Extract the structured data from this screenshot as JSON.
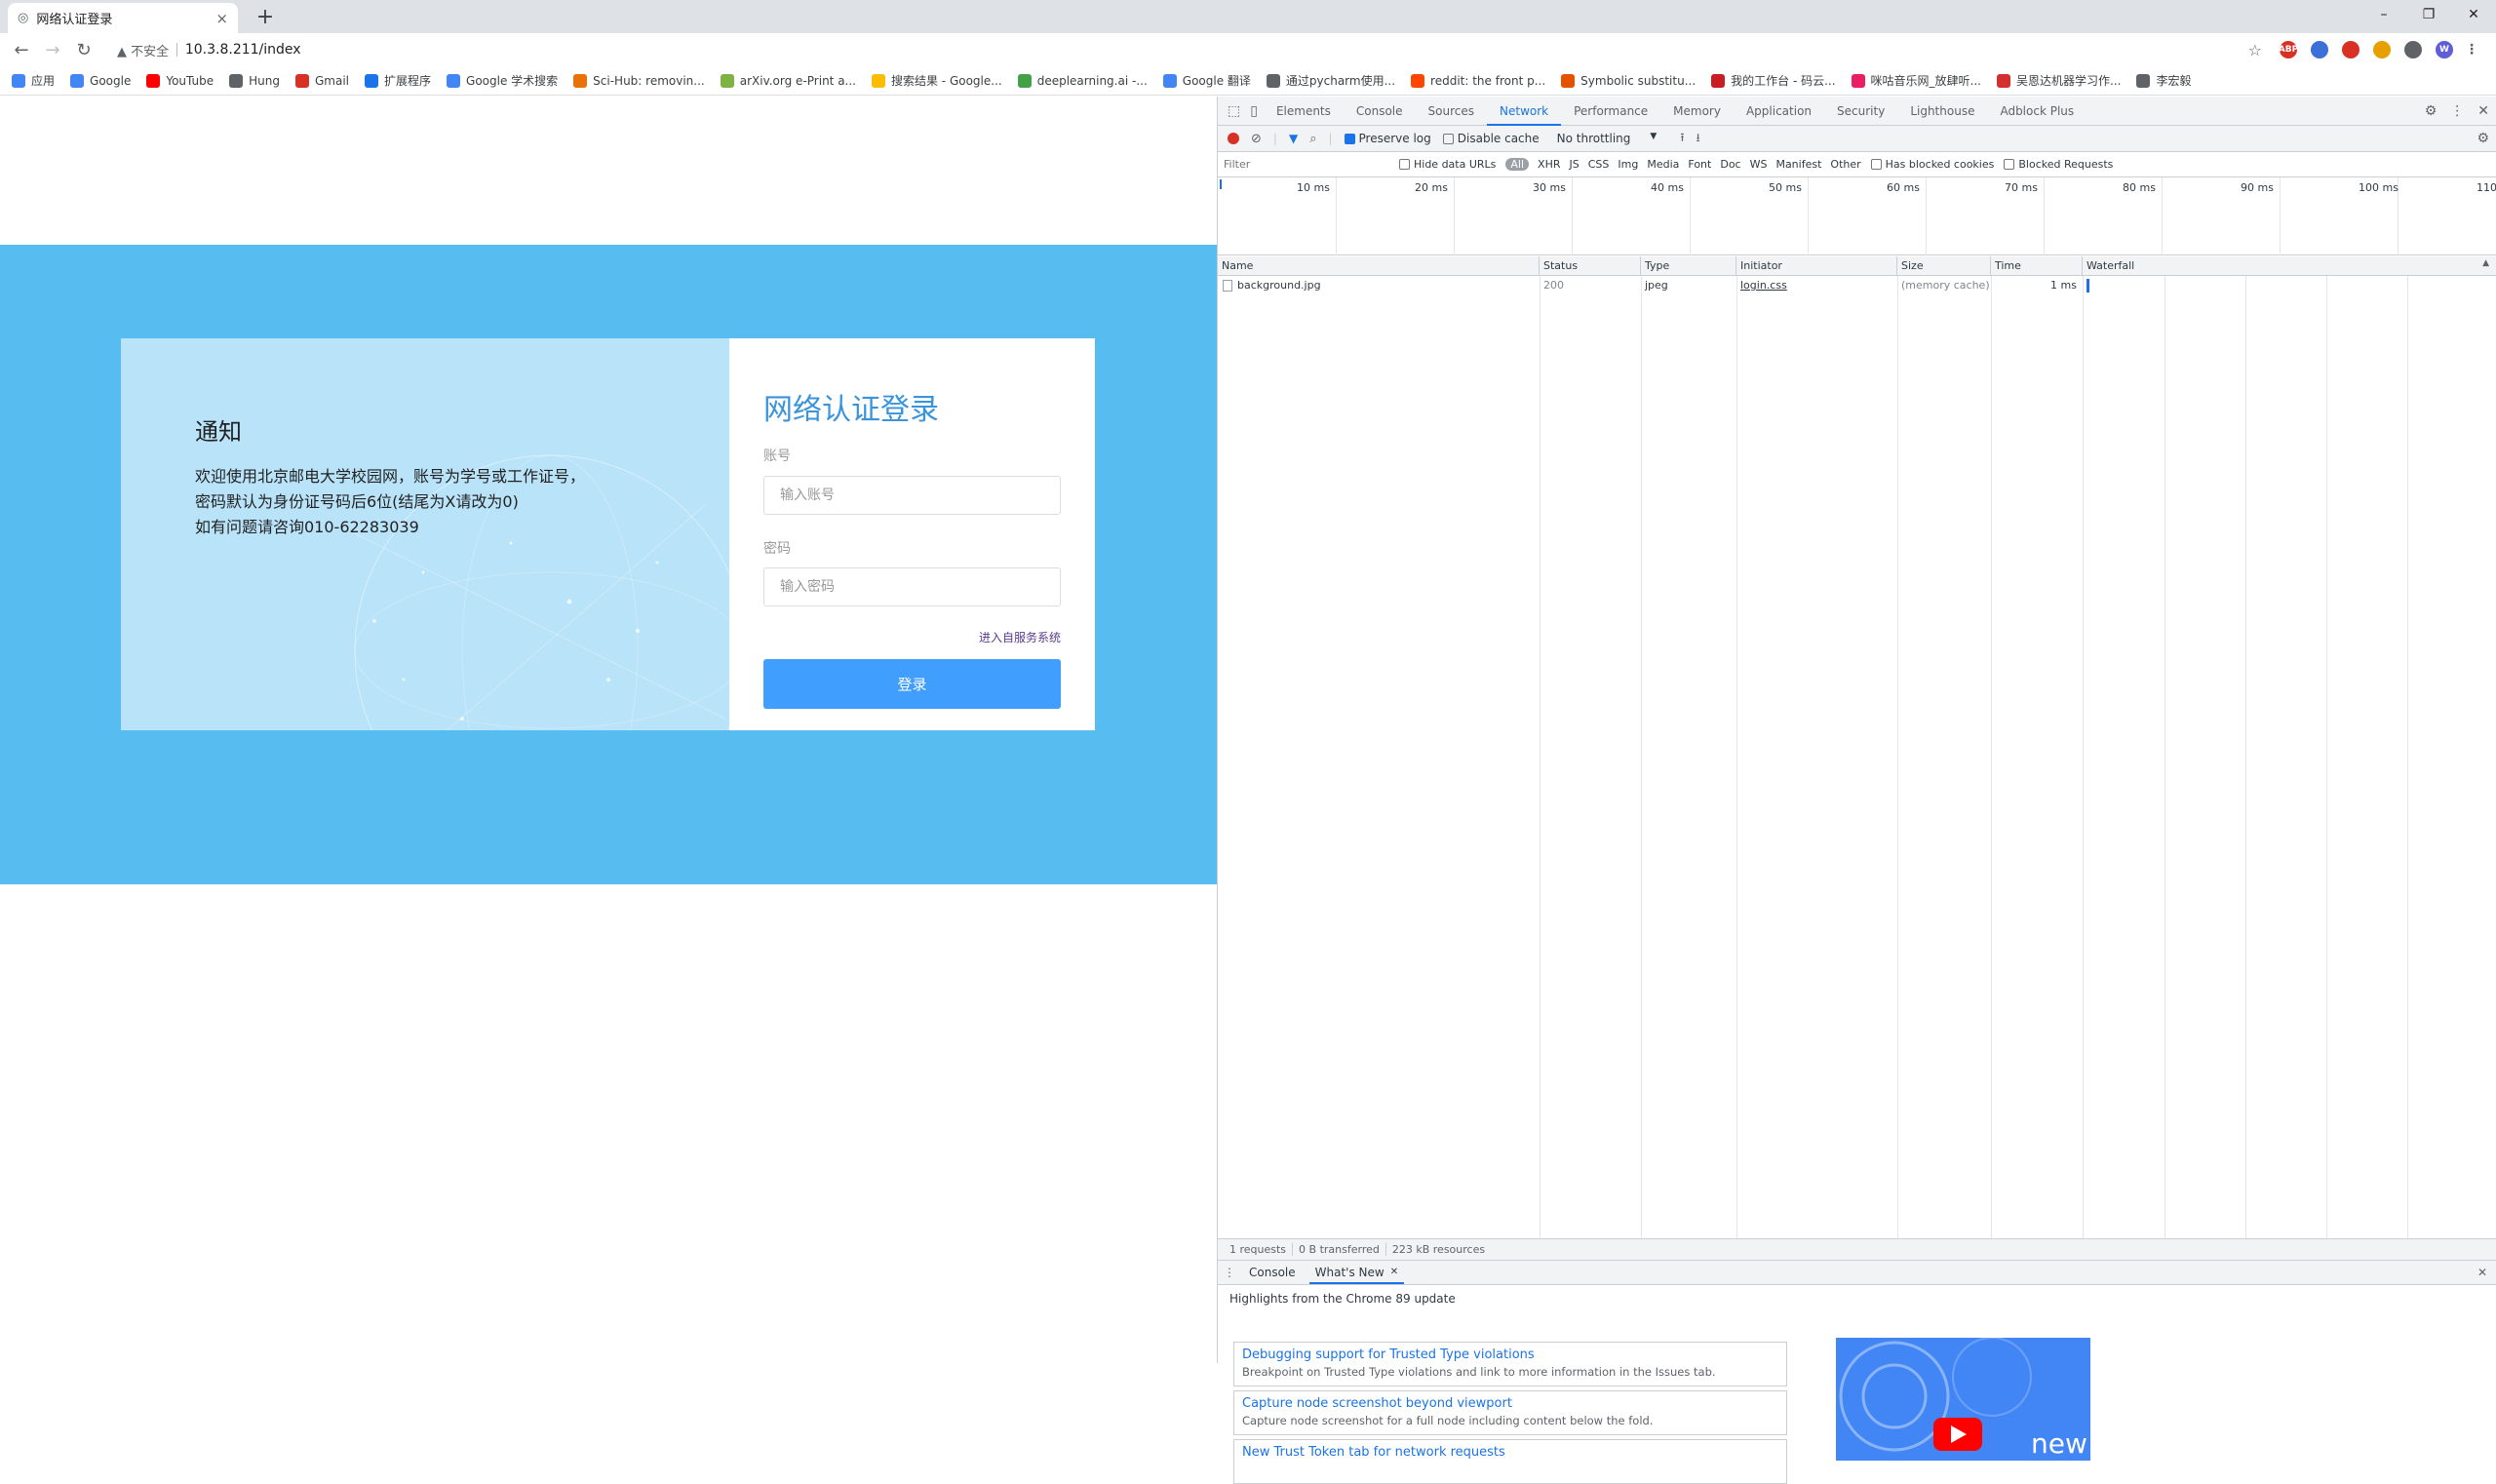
{
  "browser": {
    "tab": {
      "title": "网络认证登录",
      "close": "×"
    },
    "new_tab": "+",
    "window": {
      "minimize": "–",
      "restore": "❐",
      "close": "✕"
    },
    "nav": {
      "back": "←",
      "forward": "→",
      "reload": "↻"
    },
    "omnibox": {
      "security": "▲ 不安全",
      "url": "10.3.8.211/index"
    },
    "extensions": [
      {
        "label": "ABP",
        "color": "#d93025"
      },
      {
        "label": "",
        "color": "#3c6fd8"
      },
      {
        "label": "",
        "color": "#d93025"
      },
      {
        "label": "",
        "color": "#e8a000"
      },
      {
        "label": "",
        "color": "#5f6368"
      },
      {
        "label": "W",
        "color": "#5e5ed6"
      }
    ],
    "bookmarks": [
      {
        "label": "应用",
        "icon": "apps-grid-icon",
        "color": "#4285f4"
      },
      {
        "label": "Google",
        "icon": "google-icon",
        "color": "#4285f4"
      },
      {
        "label": "YouTube",
        "icon": "youtube-icon",
        "color": "#ff0000"
      },
      {
        "label": "Hung",
        "icon": "globe-icon",
        "color": "#5f6368"
      },
      {
        "label": "Gmail",
        "icon": "gmail-icon",
        "color": "#d93025"
      },
      {
        "label": "扩展程序",
        "icon": "puzzle-icon",
        "color": "#1a73e8"
      },
      {
        "label": "Google 学术搜索",
        "icon": "scholar-icon",
        "color": "#4285f4"
      },
      {
        "label": "Sci-Hub: removin...",
        "icon": "scihub-icon",
        "color": "#e8710a"
      },
      {
        "label": "arXiv.org e-Print a...",
        "icon": "arxiv-icon",
        "color": "#7cb342"
      },
      {
        "label": "搜索结果 - Google...",
        "icon": "drive-icon",
        "color": "#fbbc04"
      },
      {
        "label": "deeplearning.ai -...",
        "icon": "dl-icon",
        "color": "#43a047"
      },
      {
        "label": "Google 翻译",
        "icon": "translate-icon",
        "color": "#4285f4"
      },
      {
        "label": "通过pycharm使用...",
        "icon": "pycharm-icon",
        "color": "#5f6368"
      },
      {
        "label": "reddit: the front p...",
        "icon": "reddit-icon",
        "color": "#ff4500"
      },
      {
        "label": "Symbolic substitu...",
        "icon": "matlab-icon",
        "color": "#e65100"
      },
      {
        "label": "我的工作台 - 码云...",
        "icon": "gitee-icon",
        "color": "#c71d23"
      },
      {
        "label": "咪咕音乐网_放肆听...",
        "icon": "migu-icon",
        "color": "#e91e63"
      },
      {
        "label": "吴恩达机器学习作...",
        "icon": "csdn-icon",
        "color": "#d32f2f"
      },
      {
        "label": "李宏毅",
        "icon": "globe-icon",
        "color": "#5f6368"
      }
    ]
  },
  "page": {
    "notice": {
      "title": "通知",
      "lines": [
        "欢迎使用北京邮电大学校园网，账号为学号或工作证号，",
        "密码默认为身份证号码后6位(结尾为X请改为0)",
        "如有问题请咨询010-62283039"
      ]
    },
    "login": {
      "title": "网络认证登录",
      "account_label": "账号",
      "account_placeholder": "输入账号",
      "password_label": "密码",
      "password_placeholder": "输入密码",
      "self_service_link": "进入自服务系统",
      "submit_label": "登录"
    }
  },
  "devtools": {
    "tabs": [
      "Elements",
      "Console",
      "Sources",
      "Network",
      "Performance",
      "Memory",
      "Application",
      "Security",
      "Lighthouse",
      "Adblock Plus"
    ],
    "active_tab": "Network",
    "network_toolbar": {
      "preserve_log": "Preserve log",
      "disable_cache": "Disable cache",
      "throttling": "No throttling"
    },
    "filter": {
      "placeholder": "Filter",
      "hide_data_urls": "Hide data URLs",
      "types": [
        "All",
        "XHR",
        "JS",
        "CSS",
        "Img",
        "Media",
        "Font",
        "Doc",
        "WS",
        "Manifest",
        "Other"
      ],
      "has_blocked_cookies": "Has blocked cookies",
      "blocked_requests": "Blocked Requests"
    },
    "overview_ticks": [
      "10 ms",
      "20 ms",
      "30 ms",
      "40 ms",
      "50 ms",
      "60 ms",
      "70 ms",
      "80 ms",
      "90 ms",
      "100 ms",
      "110"
    ],
    "columns": [
      "Name",
      "Status",
      "Type",
      "Initiator",
      "Size",
      "Time",
      "Waterfall"
    ],
    "rows": [
      {
        "name": "background.jpg",
        "status": "200",
        "type": "jpeg",
        "initiator": "login.css",
        "size": "(memory cache)",
        "time": "1 ms"
      }
    ],
    "summary": {
      "requests": "1 requests",
      "transferred": "0 B transferred",
      "resources": "223 kB resources"
    },
    "drawer": {
      "tabs": [
        "Console",
        "What's New"
      ],
      "highlights": "Highlights from the Chrome 89 update",
      "cards": [
        {
          "title": "Debugging support for Trusted Type violations",
          "desc": "Breakpoint on Trusted Type violations and link to more information in the Issues tab."
        },
        {
          "title": "Capture node screenshot beyond viewport",
          "desc": "Capture node screenshot for a full node including content below the fold."
        },
        {
          "title": "New Trust Token tab for network requests",
          "desc": ""
        }
      ],
      "video_label": "new"
    }
  }
}
